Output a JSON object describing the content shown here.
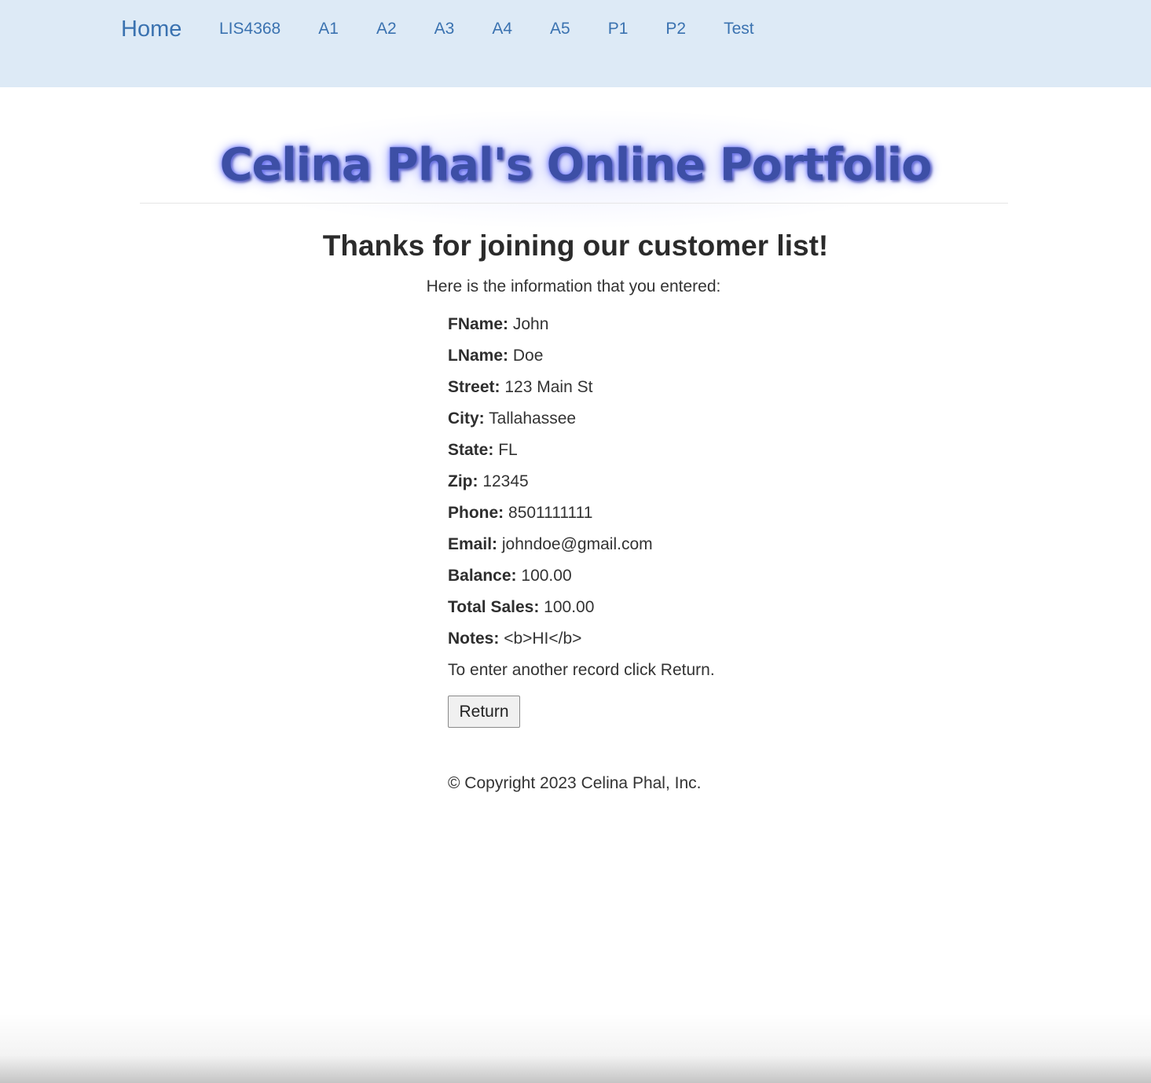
{
  "nav": {
    "brand": "Home",
    "links": [
      "LIS4368",
      "A1",
      "A2",
      "A3",
      "A4",
      "A5",
      "P1",
      "P2",
      "Test"
    ]
  },
  "header": {
    "site_title": "Celina Phal's Online Portfolio"
  },
  "main": {
    "heading": "Thanks for joining our customer list!",
    "intro": "Here is the information that you entered:",
    "fields": [
      {
        "label": "FName:",
        "value": "John"
      },
      {
        "label": "LName:",
        "value": "Doe"
      },
      {
        "label": "Street:",
        "value": "123 Main St"
      },
      {
        "label": "City:",
        "value": "Tallahassee"
      },
      {
        "label": "State:",
        "value": "FL"
      },
      {
        "label": "Zip:",
        "value": "12345"
      },
      {
        "label": "Phone:",
        "value": "8501111111"
      },
      {
        "label": "Email:",
        "value": "johndoe@gmail.com"
      },
      {
        "label": "Balance:",
        "value": "100.00"
      },
      {
        "label": "Total Sales:",
        "value": "100.00"
      },
      {
        "label": "Notes:",
        "value": "<b>HI</b>"
      }
    ],
    "prompt": "To enter another record click Return.",
    "return_label": "Return"
  },
  "footer": {
    "copyright": "© Copyright 2023 Celina Phal, Inc."
  },
  "colors": {
    "navbar_bg": "#ddeaf6",
    "link": "#3a72b0",
    "title": "#3d4fa6",
    "title_glow": "#6f78ff"
  }
}
